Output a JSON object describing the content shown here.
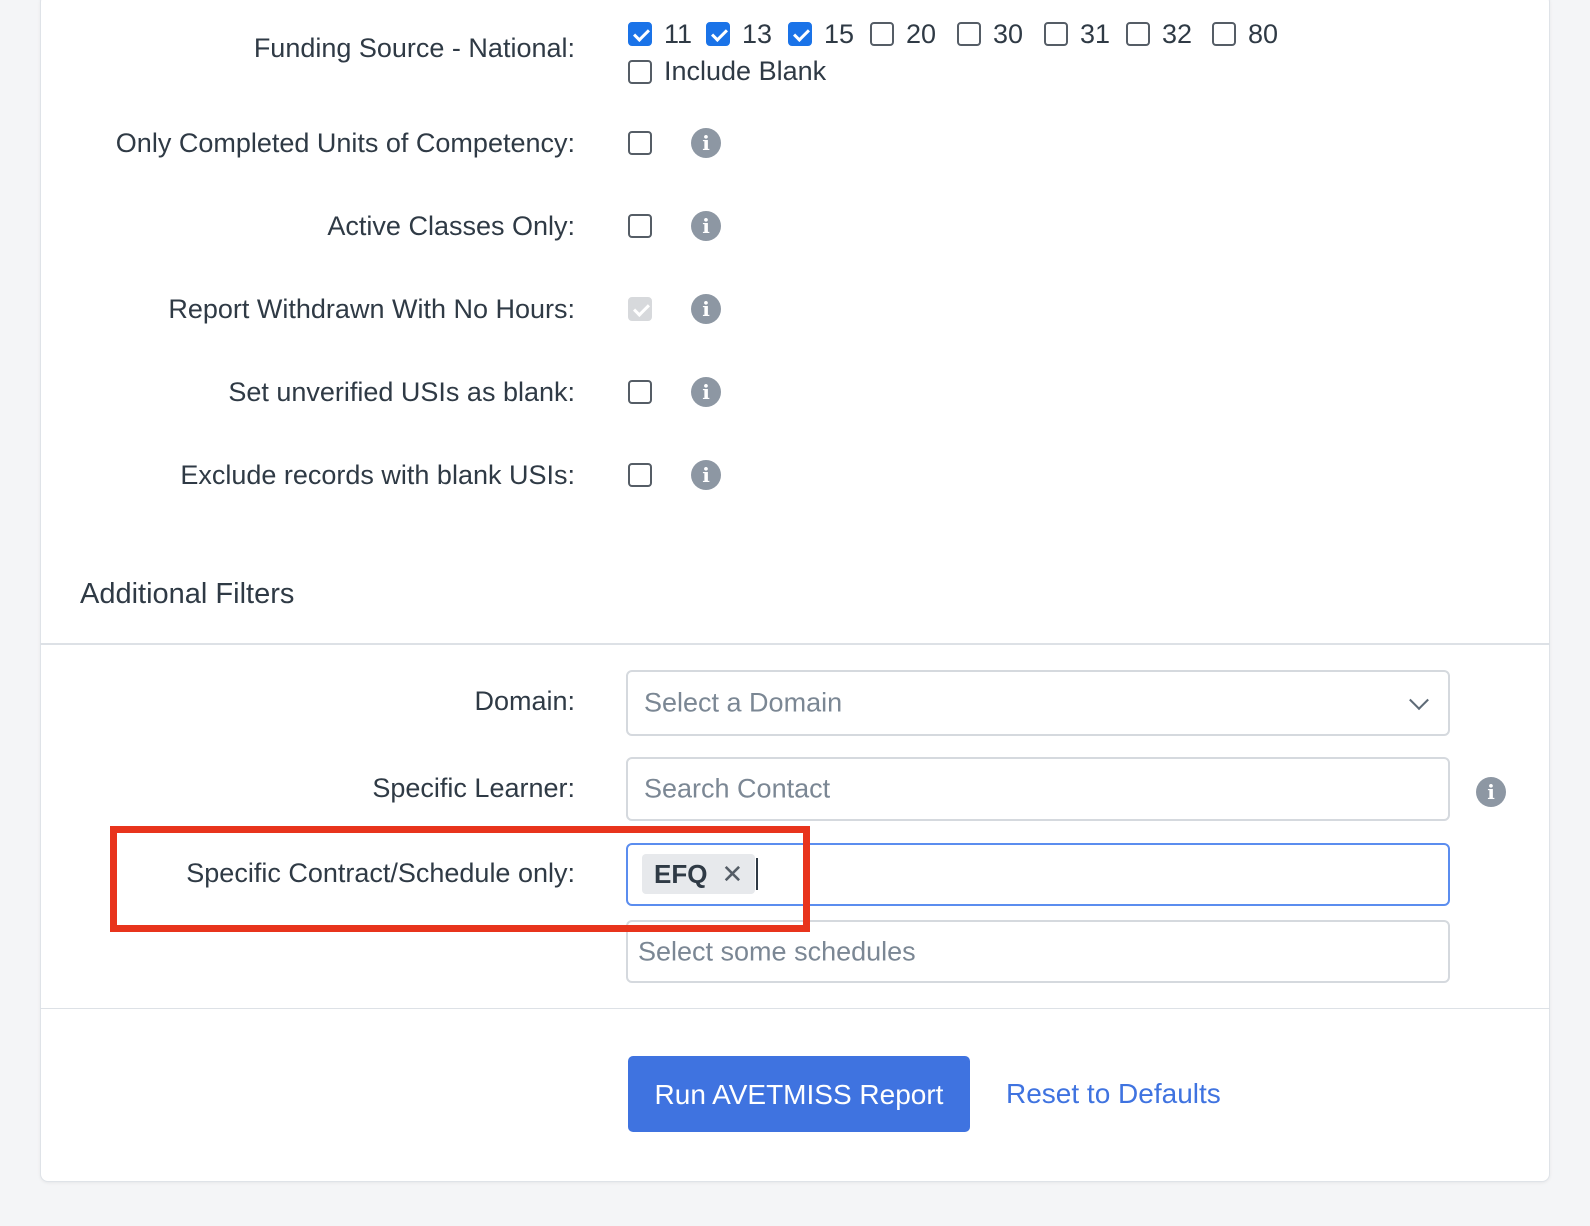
{
  "funding": {
    "label": "Funding Source - National:",
    "options": [
      {
        "value": "11",
        "checked": true
      },
      {
        "value": "13",
        "checked": true
      },
      {
        "value": "15",
        "checked": true
      },
      {
        "value": "20",
        "checked": false
      },
      {
        "value": "30",
        "checked": false
      },
      {
        "value": "31",
        "checked": false
      },
      {
        "value": "32",
        "checked": false
      },
      {
        "value": "80",
        "checked": false
      }
    ],
    "include_blank": "Include Blank"
  },
  "options": {
    "completed_units": "Only Completed Units of Competency:",
    "active_classes": "Active Classes Only:",
    "withdrawn_no_hours": "Report Withdrawn With No Hours:",
    "unverified_usis": "Set unverified USIs as blank:",
    "exclude_blank_usis": "Exclude records with blank USIs:"
  },
  "additional": {
    "title": "Additional Filters",
    "domain_label": "Domain:",
    "domain_placeholder": "Select a Domain",
    "learner_label": "Specific Learner:",
    "learner_placeholder": "Search Contact",
    "contract_label": "Specific Contract/Schedule only:",
    "contract_chip": "EFQ",
    "contract_chip_remove": "✕",
    "schedules_placeholder": "Select some schedules"
  },
  "actions": {
    "run": "Run AVETMISS Report",
    "reset": "Reset to Defaults"
  },
  "colors": {
    "primary": "#3f73e0",
    "checkbox": "#1a73e8",
    "highlight": "#e8341c",
    "info": "#8d97a3"
  },
  "icons": {
    "info": "info-icon",
    "chevron": "chevron-down-icon"
  }
}
